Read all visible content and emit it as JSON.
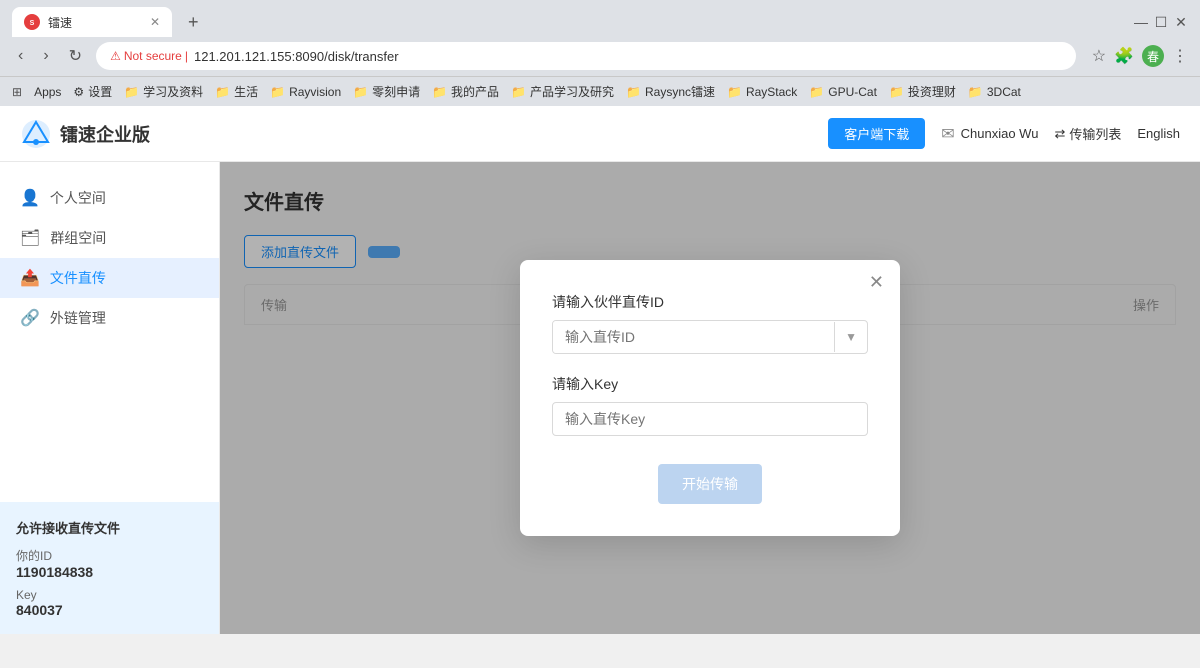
{
  "browser": {
    "tab_title": "镭速",
    "tab_favicon": "S",
    "url_not_secure": "Not secure",
    "url": "121.201.121.155:8090/disk/transfer",
    "new_tab_label": "+",
    "bookmarks": [
      {
        "label": "Apps",
        "icon": "grid"
      },
      {
        "label": "设置",
        "icon": "gear"
      },
      {
        "label": "学习及资料",
        "icon": "folder"
      },
      {
        "label": "生活",
        "icon": "folder"
      },
      {
        "label": "Rayvision",
        "icon": "folder"
      },
      {
        "label": "零刻申请",
        "icon": "folder"
      },
      {
        "label": "我的产品",
        "icon": "folder"
      },
      {
        "label": "产品学习及研究",
        "icon": "folder"
      },
      {
        "label": "Raysync镭速",
        "icon": "folder"
      },
      {
        "label": "RayStack",
        "icon": "folder"
      },
      {
        "label": "GPU-Cat",
        "icon": "folder"
      },
      {
        "label": "投资理财",
        "icon": "folder"
      },
      {
        "label": "3DCat",
        "icon": "folder"
      }
    ]
  },
  "app": {
    "logo_text": "镭速企业版",
    "header": {
      "download_btn": "客户端下载",
      "user_name": "Chunxiao Wu",
      "transfer_list": "传输列表",
      "language": "English"
    },
    "sidebar": {
      "items": [
        {
          "label": "个人空间",
          "icon": "👤",
          "active": false
        },
        {
          "label": "群组空间",
          "icon": "🗂",
          "active": false
        },
        {
          "label": "文件直传",
          "icon": "📤",
          "active": true
        },
        {
          "label": "外链管理",
          "icon": "🔗",
          "active": false
        }
      ]
    },
    "main": {
      "page_title": "文件直传",
      "add_btn": "添加直传文件",
      "table": {
        "columns": [
          "传输",
          "操作"
        ]
      },
      "info_panel": {
        "title": "允许接收直传文件",
        "id_label": "你的ID",
        "id_value": "1190184838",
        "key_label": "Key",
        "key_value": "840037"
      }
    },
    "modal": {
      "field1_label": "请输入伙伴直传ID",
      "field1_placeholder": "输入直传ID",
      "field2_label": "请输入Key",
      "field2_placeholder": "输入直传Key",
      "submit_btn": "开始传输"
    }
  }
}
